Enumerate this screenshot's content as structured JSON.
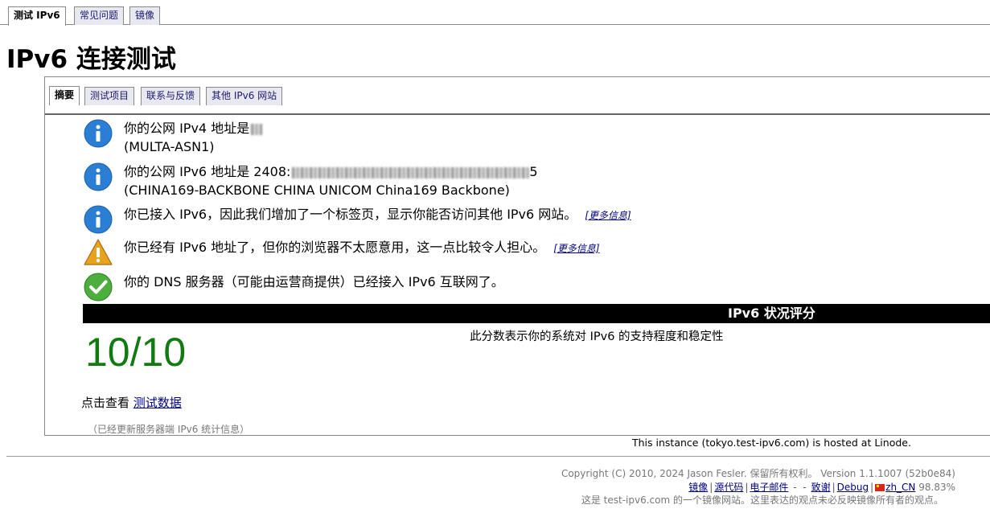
{
  "top_tabs": [
    {
      "label": "测试 IPv6"
    },
    {
      "label": "常见问题"
    },
    {
      "label": "镜像"
    }
  ],
  "page_title": "IPv6 连接测试",
  "inner_tabs": [
    {
      "label": "摘要"
    },
    {
      "label": "测试项目"
    },
    {
      "label": "联系与反馈"
    },
    {
      "label": "其他 IPv6 网站"
    }
  ],
  "results": {
    "ipv4": {
      "line1": "你的公网 IPv4 地址是",
      "line2": "(MULTA-ASN1)"
    },
    "ipv6": {
      "line1_prefix": "你的公网 IPv6 地址是 2408:",
      "line1_suffix": "5",
      "line2": "(CHINA169-BACKBONE CHINA UNICOM China169 Backbone)"
    },
    "tab_added": {
      "text": "你已接入 IPv6，因此我们增加了一个标签页，显示你能否访问其他 IPv6 网站。",
      "more": "[更多信息]"
    },
    "browser_warn": {
      "text": "你已经有 IPv6 地址了，但你的浏览器不太愿意用，这一点比较令人担心。",
      "more": "[更多信息]"
    },
    "dns": {
      "text": "你的 DNS 服务器（可能由运营商提供）已经接入 IPv6 互联网了。"
    }
  },
  "score": {
    "header": "IPv6 状况评分",
    "description": "此分数表示你的系统对 IPv6 的支持程度和稳定性",
    "value": "10/10",
    "see_prefix": "点击查看",
    "see_link": "测试数据",
    "stats_note": "（已经更新服务器端 IPv6 统计信息）"
  },
  "hosted": "This instance (tokyo.test-ipv6.com) is hosted at Linode.",
  "footer": {
    "copyright": "Copyright (C) 2010, 2024 Jason Fesler. 保留所有权利。 Version 1.1.1007 (52b0e84)",
    "links": {
      "mirror": "镜像",
      "source": "源代码",
      "email": "电子邮件",
      "thanks": "致谢",
      "debug": "Debug",
      "locale": "zh_CN",
      "locale_pct": "98.83%"
    },
    "mirror_note": "这是 test-ipv6.com 的一个镜像网站。这里表达的观点未必反映镜像所有者的观点。"
  },
  "colors": {
    "score": "#117a11",
    "info": "#2a7fd4",
    "warn": "#e8a31e",
    "ok": "#4caf3d",
    "link": "#000080"
  }
}
